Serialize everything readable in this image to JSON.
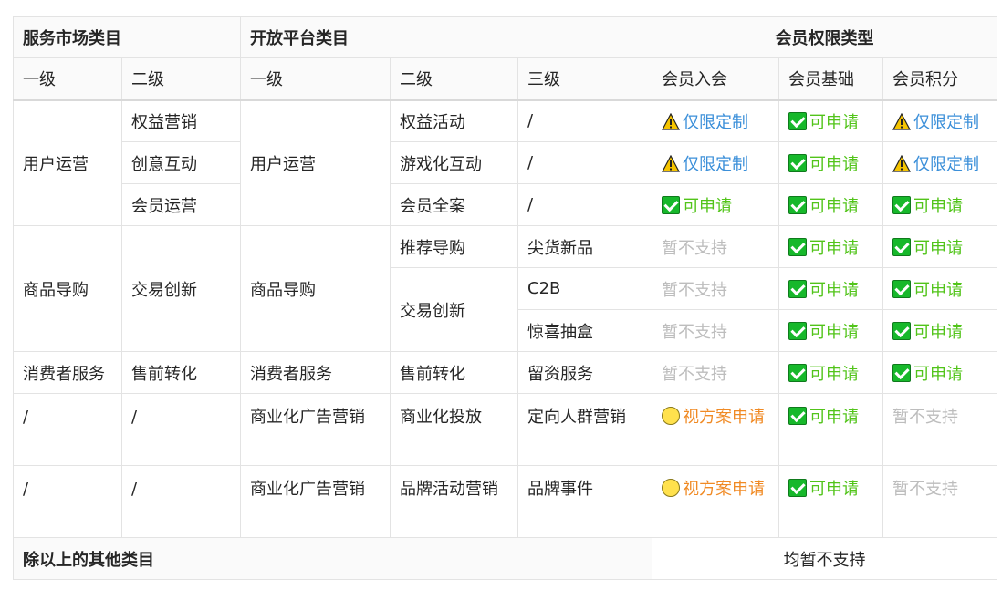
{
  "headers": {
    "service_market": "服务市场类目",
    "open_platform": "开放平台类目",
    "member_rights": "会员权限类型"
  },
  "subheaders": {
    "sm_l1": "一级",
    "sm_l2": "二级",
    "op_l1": "一级",
    "op_l2": "二级",
    "op_l3": "三级",
    "m_join": "会员入会",
    "m_basic": "会员基础",
    "m_points": "会员积分"
  },
  "rows": {
    "g1": {
      "sm_l1": "用户运营",
      "sm_l2": [
        "权益营销",
        "创意互动",
        "会员运营"
      ],
      "op_l1": "用户运营",
      "op_l2": [
        "权益活动",
        "游戏化互动",
        "会员全案"
      ],
      "op_l3": [
        "/",
        "/",
        "/"
      ]
    },
    "g2": {
      "sm_l1": "商品导购",
      "sm_l2": "交易创新",
      "op_l1": "商品导购",
      "op_l2": [
        "推荐导购",
        "交易创新"
      ],
      "op_l3": [
        "尖货新品",
        "C2B",
        "惊喜抽盒"
      ]
    },
    "g3": {
      "sm_l1": "消费者服务",
      "sm_l2": "售前转化",
      "op_l1": "消费者服务",
      "op_l2": "售前转化",
      "op_l3": "留资服务"
    },
    "g4": {
      "sm_l1": "/",
      "sm_l2": "/",
      "op_l1": "商业化广告营销",
      "op_l2": "商业化投放",
      "op_l3": "定向人群营销"
    },
    "g5": {
      "sm_l1": "/",
      "sm_l2": "/",
      "op_l1": "商业化广告营销",
      "op_l2": "品牌活动营销",
      "op_l3": "品牌事件"
    }
  },
  "status": {
    "limited": "仅限定制",
    "apply": "可申请",
    "unsupported": "暂不支持",
    "case_by_case": "视方案申请"
  },
  "footer": {
    "others": "除以上的其他类目",
    "all_unsupported": "均暂不支持"
  },
  "colors": {
    "limited": "#3b8fd9",
    "apply": "#52c41a",
    "case_by_case": "#f08a24",
    "unsupported": "#bdbdbd"
  },
  "icons": {
    "limited": "warning-icon",
    "apply": "check-box-icon",
    "case_by_case": "yellow-circle-icon"
  }
}
